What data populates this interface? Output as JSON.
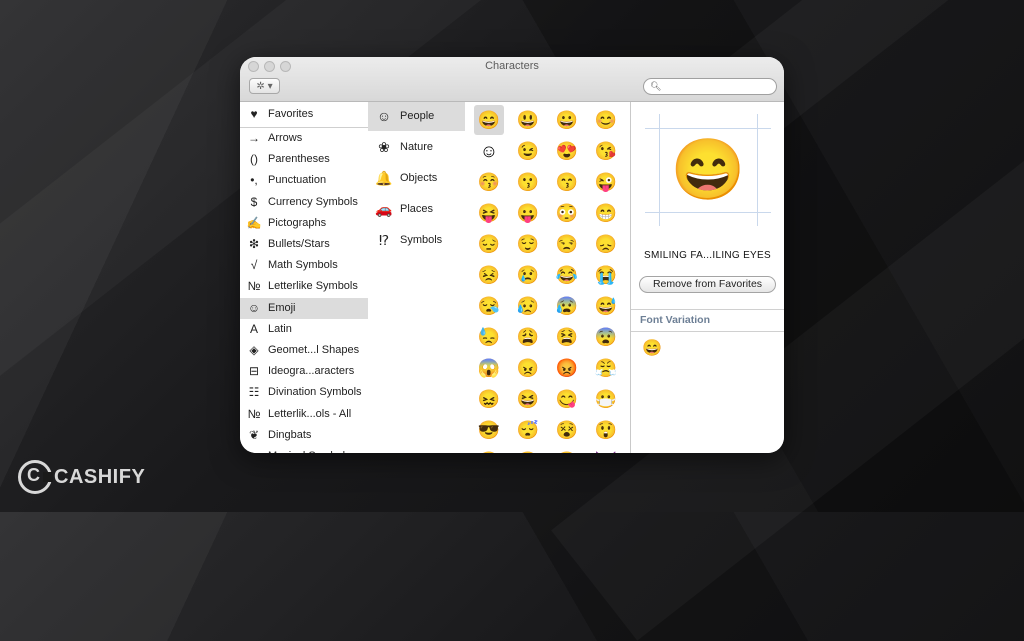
{
  "window": {
    "title": "Characters",
    "gear_label": "✲ ▾",
    "search": {
      "value": "",
      "placeholder": ""
    }
  },
  "categories": [
    {
      "icon": "♥",
      "icon_name": "heart-icon",
      "label": "Favorites",
      "selected": false
    },
    {
      "icon": "→",
      "icon_name": "arrow-icon",
      "label": "Arrows",
      "selected": false
    },
    {
      "icon": "()",
      "icon_name": "parentheses-icon",
      "label": "Parentheses",
      "selected": false
    },
    {
      "icon": "•,",
      "icon_name": "punctuation-icon",
      "label": "Punctuation",
      "selected": false
    },
    {
      "icon": "$",
      "icon_name": "dollar-icon",
      "label": "Currency Symbols",
      "selected": false
    },
    {
      "icon": "✍",
      "icon_name": "pictograph-icon",
      "label": "Pictographs",
      "selected": false
    },
    {
      "icon": "❇",
      "icon_name": "bullet-star-icon",
      "label": "Bullets/Stars",
      "selected": false
    },
    {
      "icon": "√",
      "icon_name": "square-root-icon",
      "label": "Math Symbols",
      "selected": false
    },
    {
      "icon": "№",
      "icon_name": "numero-icon",
      "label": "Letterlike Symbols",
      "selected": false
    },
    {
      "icon": "☺",
      "icon_name": "smiley-icon",
      "label": "Emoji",
      "selected": true
    },
    {
      "icon": "A",
      "icon_name": "latin-letter-icon",
      "label": "Latin",
      "selected": false
    },
    {
      "icon": "◈",
      "icon_name": "diamond-shape-icon",
      "label": "Geomet...l Shapes",
      "selected": false
    },
    {
      "icon": "⊟",
      "icon_name": "ideograph-icon",
      "label": "Ideogra...aracters",
      "selected": false
    },
    {
      "icon": "☷",
      "icon_name": "trigram-icon",
      "label": "Divination Symbols",
      "selected": false
    },
    {
      "icon": "№",
      "icon_name": "numero-icon",
      "label": "Letterlik...ols - All",
      "selected": false
    },
    {
      "icon": "❦",
      "icon_name": "dingbat-icon",
      "label": "Dingbats",
      "selected": false
    },
    {
      "icon": "♪",
      "icon_name": "music-note-icon",
      "label": "Musical Symbols",
      "selected": false
    }
  ],
  "subcategories": [
    {
      "icon": "☺",
      "icon_name": "smiley-face-icon",
      "label": "People",
      "selected": true
    },
    {
      "icon": "❀",
      "icon_name": "flower-icon",
      "label": "Nature",
      "selected": false
    },
    {
      "icon": "🔔",
      "icon_name": "bell-icon",
      "label": "Objects",
      "selected": false
    },
    {
      "icon": "🚗",
      "icon_name": "car-icon",
      "label": "Places",
      "selected": false
    },
    {
      "icon": "⁉",
      "icon_name": "symbols-icon",
      "label": "Symbols",
      "selected": false
    }
  ],
  "emoji_grid": [
    "😄",
    "😃",
    "😀",
    "😊",
    "☺",
    "😉",
    "😍",
    "😘",
    "😚",
    "😗",
    "😙",
    "😜",
    "😝",
    "😛",
    "😳",
    "😁",
    "😔",
    "😌",
    "😒",
    "😞",
    "😣",
    "😢",
    "😂",
    "😭",
    "😪",
    "😥",
    "😰",
    "😅",
    "😓",
    "😩",
    "😫",
    "😨",
    "😱",
    "😠",
    "😡",
    "😤",
    "😖",
    "😆",
    "😋",
    "😷",
    "😎",
    "😴",
    "😵",
    "😲",
    "😟",
    "😦",
    "😧",
    "😈"
  ],
  "detail": {
    "glyph": "😄",
    "char_name": "SMILING FA...ILING EYES",
    "favorite_button": "Remove from Favorites",
    "font_variation_title": "Font Variation",
    "font_variations": [
      "😄"
    ]
  },
  "brand": {
    "logo_letter": "C",
    "name": "CASHIFY"
  }
}
